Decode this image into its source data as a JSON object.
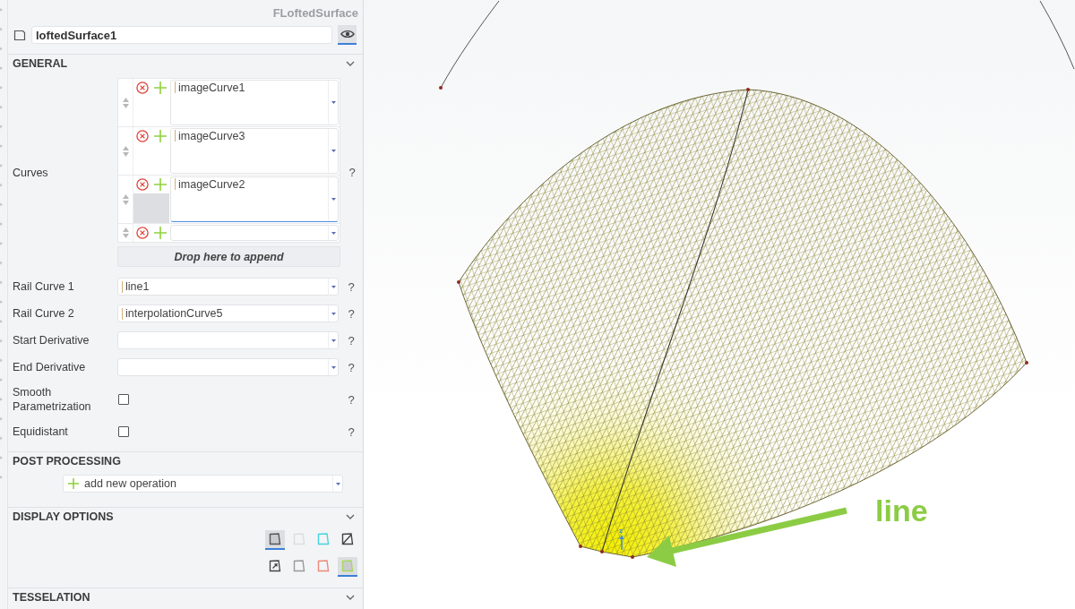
{
  "header": {
    "type_label": "FLoftedSurface",
    "name": "loftedSurface1",
    "visible": true
  },
  "sections": [
    {
      "kind": "general",
      "title": "GENERAL",
      "expanded": true,
      "properties": [
        {
          "kind": "curve_list",
          "label": "Curves",
          "help": "?",
          "items": [
            {
              "value": "imageCurve1",
              "selected": false
            },
            {
              "value": "imageCurve3",
              "selected": false
            },
            {
              "value": "imageCurve2",
              "selected": true
            },
            {
              "selected": false
            }
          ],
          "drop_hint": "Drop here to append"
        },
        {
          "kind": "reference",
          "label": "Rail Curve 1",
          "value": "line1",
          "help": "?"
        },
        {
          "kind": "reference",
          "label": "Rail Curve 2",
          "value": "interpolationCurve5",
          "help": "?"
        },
        {
          "kind": "reference",
          "label": "Start Derivative",
          "help": "?"
        },
        {
          "kind": "reference",
          "label": "End Derivative",
          "help": "?"
        },
        {
          "kind": "checkbox",
          "label": "Smooth Parametrization",
          "checked": false,
          "help": "?"
        },
        {
          "kind": "checkbox",
          "label": "Equidistant",
          "checked": false,
          "help": "?"
        }
      ]
    },
    {
      "kind": "post_processing",
      "title": "POST PROCESSING",
      "add_operation": "add new operation"
    },
    {
      "kind": "display_options",
      "title": "DISPLAY OPTIONS",
      "expanded": true,
      "modes": [
        {
          "kind": "shaded",
          "color": "#555555",
          "selected": true
        },
        {
          "kind": "outline",
          "color": "#dddddd",
          "selected": false
        },
        {
          "kind": "outline",
          "color": "#44d4dc",
          "selected": false
        },
        {
          "kind": "diagonal",
          "color": "#444444",
          "selected": false
        },
        {
          "kind": "arrow",
          "color": "#444444",
          "selected": false
        },
        {
          "kind": "outline",
          "color": "#999999",
          "selected": false
        },
        {
          "kind": "outline",
          "color": "#ec8a7c",
          "selected": false
        },
        {
          "kind": "shaded",
          "color": "#a8d860",
          "selected": true
        }
      ]
    },
    {
      "kind": "tesselation",
      "title": "TESSELATION",
      "expanded": true
    }
  ],
  "viewport": {
    "axis_label": "z",
    "annotation": "line"
  }
}
